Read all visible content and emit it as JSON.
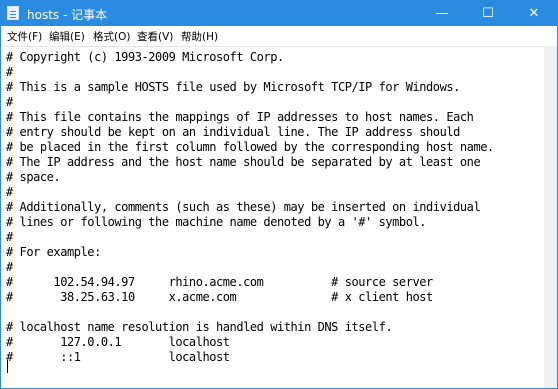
{
  "window": {
    "title": "hosts - 记事本",
    "minimize_glyph": "—",
    "maximize_glyph": "☐",
    "close_glyph": "✕"
  },
  "menubar": {
    "items": [
      "文件(F)",
      "编辑(E)",
      "格式(O)",
      "查看(V)",
      "帮助(H)"
    ]
  },
  "editor": {
    "lines": [
      "# Copyright (c) 1993-2009 Microsoft Corp.",
      "#",
      "# This is a sample HOSTS file used by Microsoft TCP/IP for Windows.",
      "#",
      "# This file contains the mappings of IP addresses to host names. Each",
      "# entry should be kept on an individual line. The IP address should",
      "# be placed in the first column followed by the corresponding host name.",
      "# The IP address and the host name should be separated by at least one",
      "# space.",
      "#",
      "# Additionally, comments (such as these) may be inserted on individual",
      "# lines or following the machine name denoted by a '#' symbol.",
      "#",
      "# For example:",
      "#",
      "#      102.54.94.97     rhino.acme.com          # source server",
      "#       38.25.63.10     x.acme.com              # x client host",
      "",
      "# localhost name resolution is handled within DNS itself.",
      "#       127.0.0.1       localhost",
      "#       ::1             localhost",
      ""
    ]
  }
}
